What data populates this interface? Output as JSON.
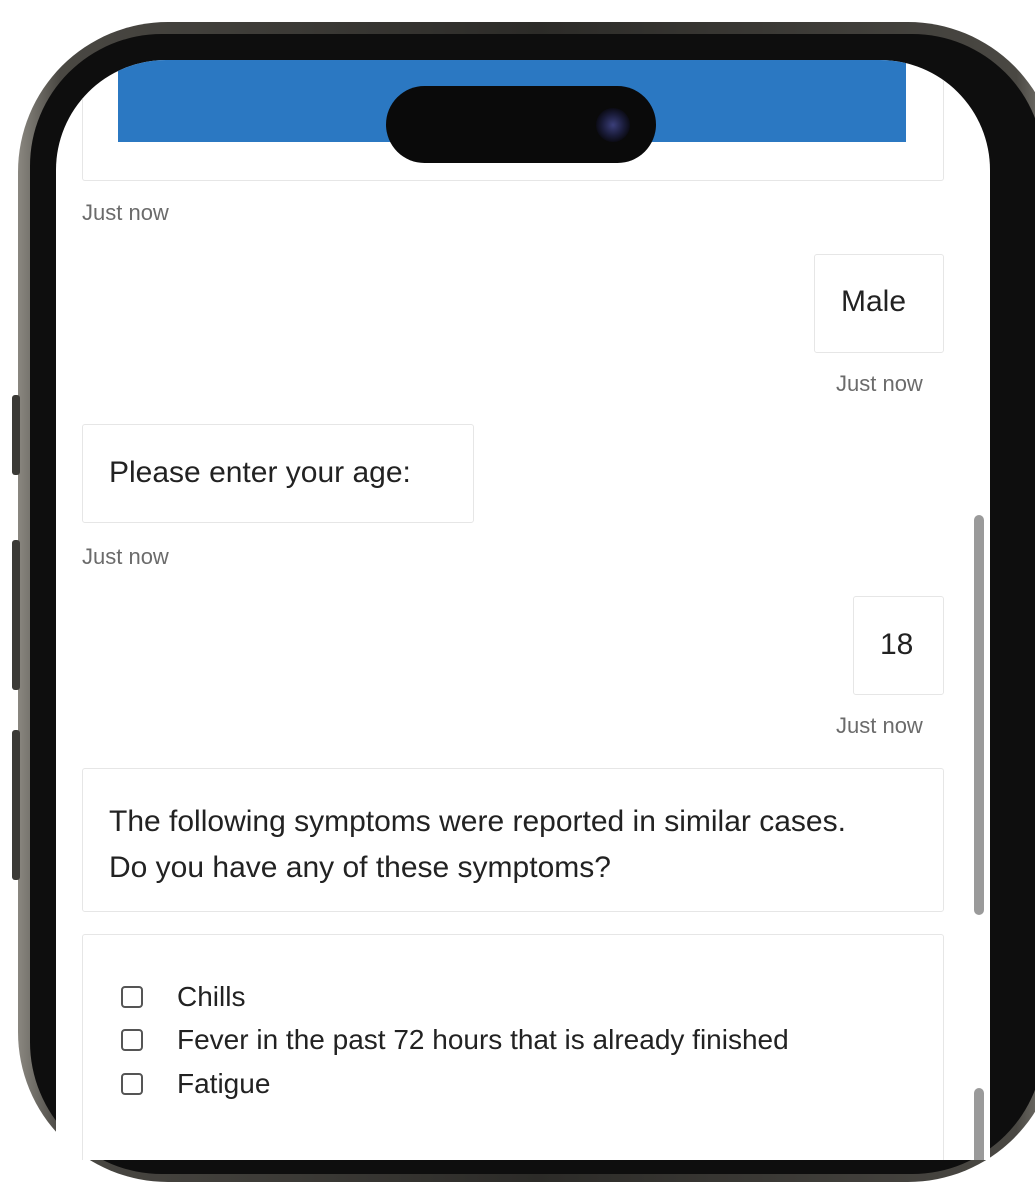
{
  "chat": {
    "top_card_timestamp": "Just now",
    "messages": [
      {
        "role": "user",
        "text": "Male",
        "timestamp": "Just now"
      },
      {
        "role": "bot",
        "text": "Please enter your age:",
        "timestamp": "Just now"
      },
      {
        "role": "user",
        "text": "18",
        "timestamp": "Just now"
      },
      {
        "role": "bot",
        "text": "The following symptoms were reported in similar cases. Do you have any of these symptoms?"
      }
    ],
    "symptoms": [
      {
        "label": "Chills",
        "checked": false
      },
      {
        "label": "Fever in the past 72 hours that is already finished",
        "checked": false
      },
      {
        "label": "Fatigue",
        "checked": false
      }
    ]
  },
  "colors": {
    "header_blue": "#2b78c2",
    "card_border": "#e6e6e6",
    "timestamp_gray": "#6b6b6b"
  }
}
